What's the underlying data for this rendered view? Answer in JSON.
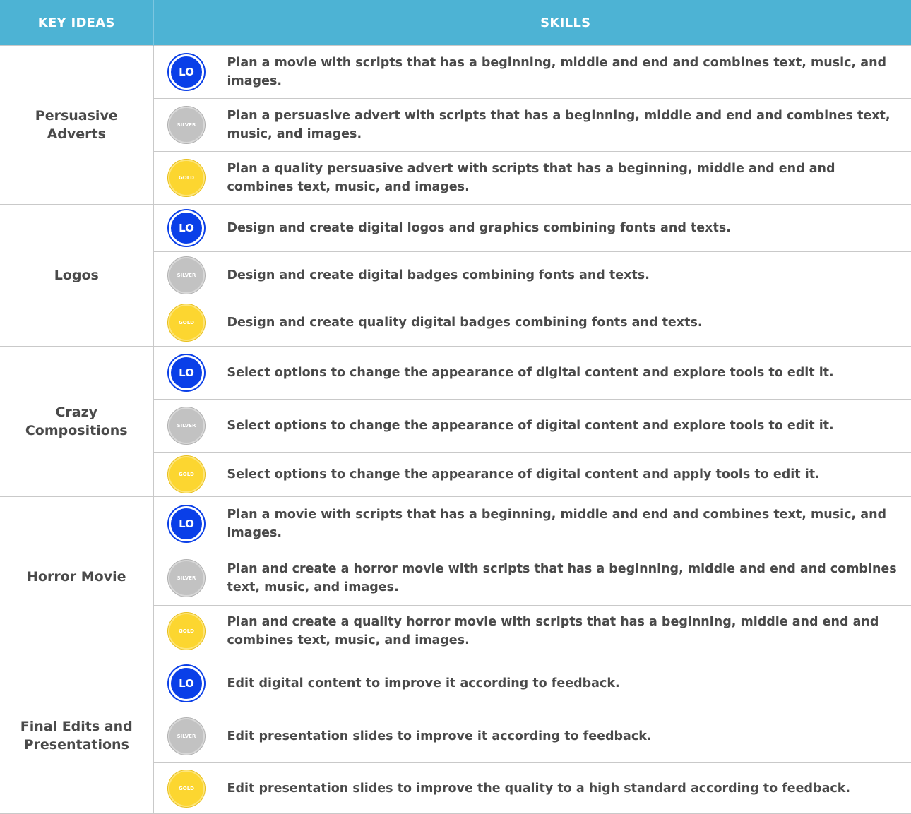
{
  "header": {
    "key_ideas": "KEY IDEAS",
    "skills": "SKILLS"
  },
  "badges": {
    "lo": "LO",
    "silver": "SILVER",
    "gold": "GOLD"
  },
  "colors": {
    "header_bg": "#4db3d4",
    "lo": "#0a3fe8",
    "silver": "#c2c2c2",
    "gold": "#fcd630",
    "text": "#4a4a4a"
  },
  "rows": [
    {
      "topic": "Persuasive Adverts",
      "skills": [
        "Plan a movie with scripts that has a beginning, middle and end and combines text, music, and images.",
        "Plan a persuasive advert with scripts that has a beginning, middle and end and combines text, music, and images.",
        "Plan a quality persuasive advert with scripts that has a beginning, middle and end and combines text, music, and images."
      ]
    },
    {
      "topic": "Logos",
      "skills": [
        "Design and create digital logos and graphics combining fonts and texts.",
        "Design and create digital badges combining fonts and texts.",
        "Design and create quality digital badges combining fonts and texts."
      ]
    },
    {
      "topic": "Crazy Compositions",
      "skills": [
        "Select options to change the appearance of digital content and explore tools to edit it.",
        "Select options to change the appearance of digital content and explore tools to edit it.",
        "Select options to change the appearance of digital content and apply tools to edit it."
      ]
    },
    {
      "topic": "Horror Movie",
      "skills": [
        "Plan a movie with scripts that has a beginning, middle and end and combines text, music, and images.",
        "Plan and create a horror movie with scripts that has a beginning, middle and end and combines text, music, and images.",
        "Plan and create a quality horror movie with scripts that has a beginning, middle and end and combines text, music, and images."
      ]
    },
    {
      "topic": "Final Edits and Presentations",
      "skills": [
        "Edit digital content to improve it according to feedback.",
        "Edit presentation slides to improve it according to feedback.",
        "Edit presentation slides to improve the quality to a high standard according to feedback."
      ]
    }
  ]
}
